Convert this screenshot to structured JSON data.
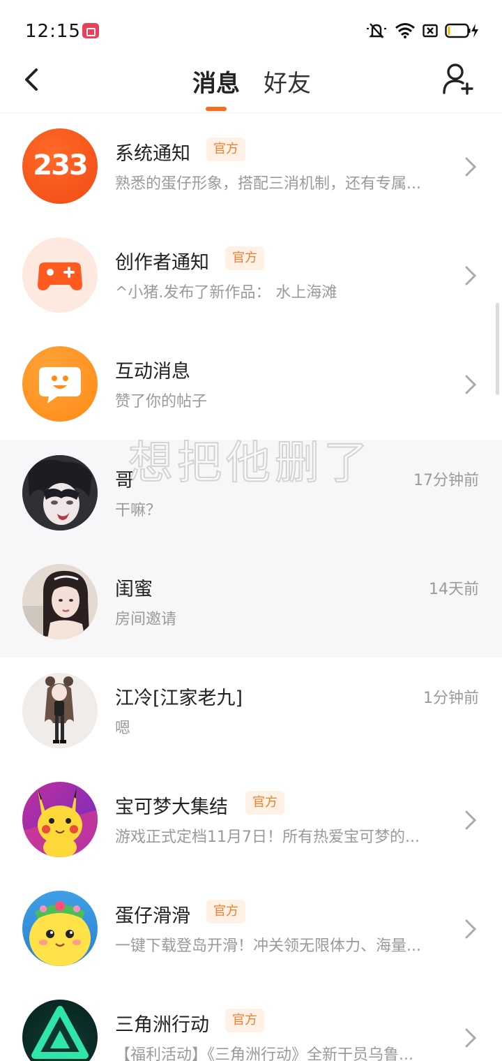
{
  "status_bar": {
    "time": "12:15"
  },
  "header": {
    "tabs": [
      {
        "label": "消息",
        "active": true
      },
      {
        "label": "好友",
        "active": false
      }
    ]
  },
  "colors": {
    "accent": "#ff6a1a",
    "badge_text": "#f07f2d",
    "badge_bg": "#fff1e6"
  },
  "overlay_text": "想把他删了",
  "messages": [
    {
      "title": "系统通知",
      "badge": "官方",
      "subtitle": "熟悉的蛋仔形象，搭配三消机制，还有专属...",
      "time": "",
      "avatar_text": "233",
      "avatar": "233-logo-icon",
      "has_chevron": true
    },
    {
      "title": "创作者通知",
      "badge": "官方",
      "subtitle": "^小猪.发布了新作品：  水上海滩",
      "time": "",
      "avatar": "gamepad-icon",
      "has_chevron": true
    },
    {
      "title": "互动消息",
      "badge": "",
      "subtitle": "赞了你的帖子",
      "time": "",
      "avatar": "chat-bubble-smile-icon",
      "has_chevron": true
    },
    {
      "title": "哥",
      "badge": "",
      "subtitle": "干嘛？",
      "time": "17分钟前",
      "avatar": "anime-boy-avatar",
      "has_chevron": false
    },
    {
      "title": "闺蜜",
      "badge": "",
      "subtitle": "房间邀请",
      "time": "14天前",
      "avatar": "girl-photo-avatar",
      "has_chevron": false
    },
    {
      "title": "江冷[江家老九]",
      "badge": "",
      "subtitle": "嗯",
      "time": "1分钟前",
      "avatar": "doll-figure-avatar",
      "has_chevron": false
    },
    {
      "title": "宝可梦大集结",
      "badge": "官方",
      "subtitle": "游戏正式定档11月7日！所有热爱宝可梦的...",
      "time": "",
      "avatar": "pikachu-avatar",
      "has_chevron": true
    },
    {
      "title": "蛋仔滑滑",
      "badge": "官方",
      "subtitle": "一键下载登岛开滑！冲关领无限体力、海量...",
      "time": "",
      "avatar": "eggy-avatar",
      "has_chevron": true
    },
    {
      "title": "三角洲行动",
      "badge": "官方",
      "subtitle": "【福利活动】《三角洲行动》全新干员乌鲁...",
      "time": "",
      "avatar": "delta-force-logo-icon",
      "has_chevron": true
    }
  ]
}
